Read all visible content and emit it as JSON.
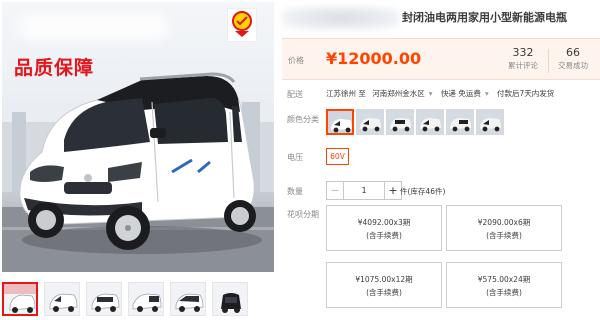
{
  "gallery": {
    "banner_text": "品质保障",
    "thumbnail_count": 6,
    "active_thumbnail": 0
  },
  "product": {
    "title": "封闭油电两用家用小型新能源电瓶"
  },
  "price": {
    "label": "价格",
    "value": "¥12000.00",
    "reviews_count": "332",
    "reviews_label": "累计评论",
    "sales_count": "66",
    "sales_label": "交易成功"
  },
  "shipping": {
    "label": "配送",
    "origin": "江苏徐州 至",
    "destination": "河南郑州金水区",
    "express": "快递 免运费",
    "note": "付款后7天内发货"
  },
  "color": {
    "label": "颜色分类",
    "swatch_count": 6,
    "selected": 0
  },
  "voltage": {
    "label": "电压",
    "option": "60V"
  },
  "quantity": {
    "label": "数量",
    "minus": "−",
    "value": "1",
    "plus": "+",
    "stock_text": "件(库存46件)"
  },
  "installment": {
    "label": "花呗分期",
    "options": [
      {
        "amount": "¥4092.00x3期",
        "fee": "(含手续费)"
      },
      {
        "amount": "¥2090.00x6期",
        "fee": "(含手续费)"
      },
      {
        "amount": "¥1075.00x12期",
        "fee": "(含手续费)"
      },
      {
        "amount": "¥575.00x24期",
        "fee": "(含手续费)"
      }
    ]
  },
  "colors": {
    "accent": "#ff4400",
    "brand_red": "#e4161b",
    "price_bg": "#fff3ee"
  }
}
